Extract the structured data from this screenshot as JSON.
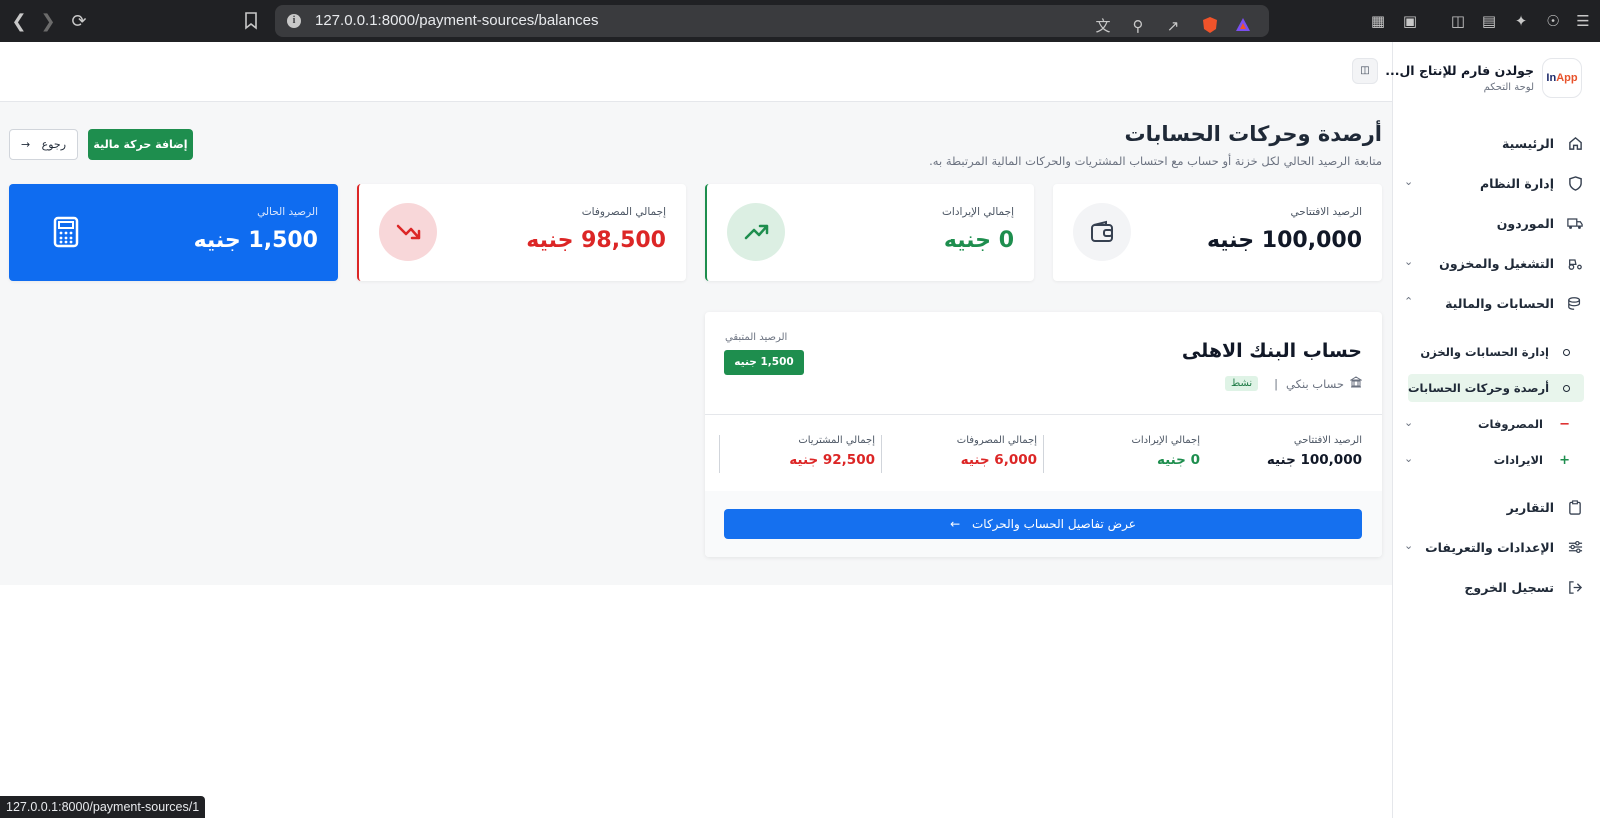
{
  "browser": {
    "url": "127.0.0.1:8000/payment-sources/balances",
    "status_url": "127.0.0.1:8000/payment-sources/1"
  },
  "brand": {
    "name": "جولدن فارم للإنتاج ال...",
    "subtitle": "لوحة التحكم",
    "logo_in": "In",
    "logo_app": "App"
  },
  "sidebar": {
    "items": [
      {
        "label": "الرئيسية"
      },
      {
        "label": "إدارة النظام"
      },
      {
        "label": "الموردون"
      },
      {
        "label": "التشغيل والمخزون"
      },
      {
        "label": "الحسابات والمالية"
      },
      {
        "label": "التقارير"
      },
      {
        "label": "الإعدادات والتعريفات"
      },
      {
        "label": "تسجيل الخروج"
      }
    ],
    "sub_items": [
      {
        "label": "إدارة الحسابات والخزن"
      },
      {
        "label": "أرصدة وحركات الحسابات"
      },
      {
        "label": "المصروفات",
        "sign": "−"
      },
      {
        "label": "الايرادات",
        "sign": "+"
      }
    ]
  },
  "header": {
    "title": "أرصدة وحركات الحسابات",
    "subtitle": "متابعة الرصيد الحالي لكل خزنة أو حساب مع احتساب المشتريات والحركات المالية المرتبطة به.",
    "add_button": "إضافة حركة مالية",
    "back_button": "رجوع",
    "back_arrow": "→"
  },
  "stats": [
    {
      "label": "الرصيد الافتتاحي",
      "value": "100,000 جنيه",
      "color": "#111827"
    },
    {
      "label": "إجمالي الإيرادات",
      "value": "0 جنيه",
      "color": "#1e8e4e"
    },
    {
      "label": "إجمالي المصروفات",
      "value": "98,500 جنيه",
      "color": "#dc2626"
    },
    {
      "label": "الرصيد الحالي",
      "value": "1,500 جنيه",
      "color": "#ffffff"
    }
  ],
  "account": {
    "name": "حساب البنك الاهلى",
    "type": "حساب بنكي",
    "separator": "|",
    "status": "نشط",
    "remaining_label": "الرصيد المتبقي",
    "remaining_value": "1,500 جنيه",
    "stats": [
      {
        "label": "الرصيد الافتتاحي",
        "value": "100,000 جنيه",
        "color": "#111827"
      },
      {
        "label": "إجمالي الإيرادات",
        "value": "0 جنيه",
        "color": "#1e8e4e"
      },
      {
        "label": "إجمالي المصروفات",
        "value": "6,000 جنيه",
        "color": "#dc2626"
      },
      {
        "label": "إجمالي المشتريات",
        "value": "92,500 جنيه",
        "color": "#dc2626"
      }
    ],
    "details_button": "عرض تفاصيل الحساب والحركات",
    "details_arrow": "←"
  },
  "colors": {
    "primary_green": "#1e8e4e",
    "primary_blue": "#1570ef",
    "danger_red": "#dc2626",
    "current_card": "#0f6cf0"
  }
}
